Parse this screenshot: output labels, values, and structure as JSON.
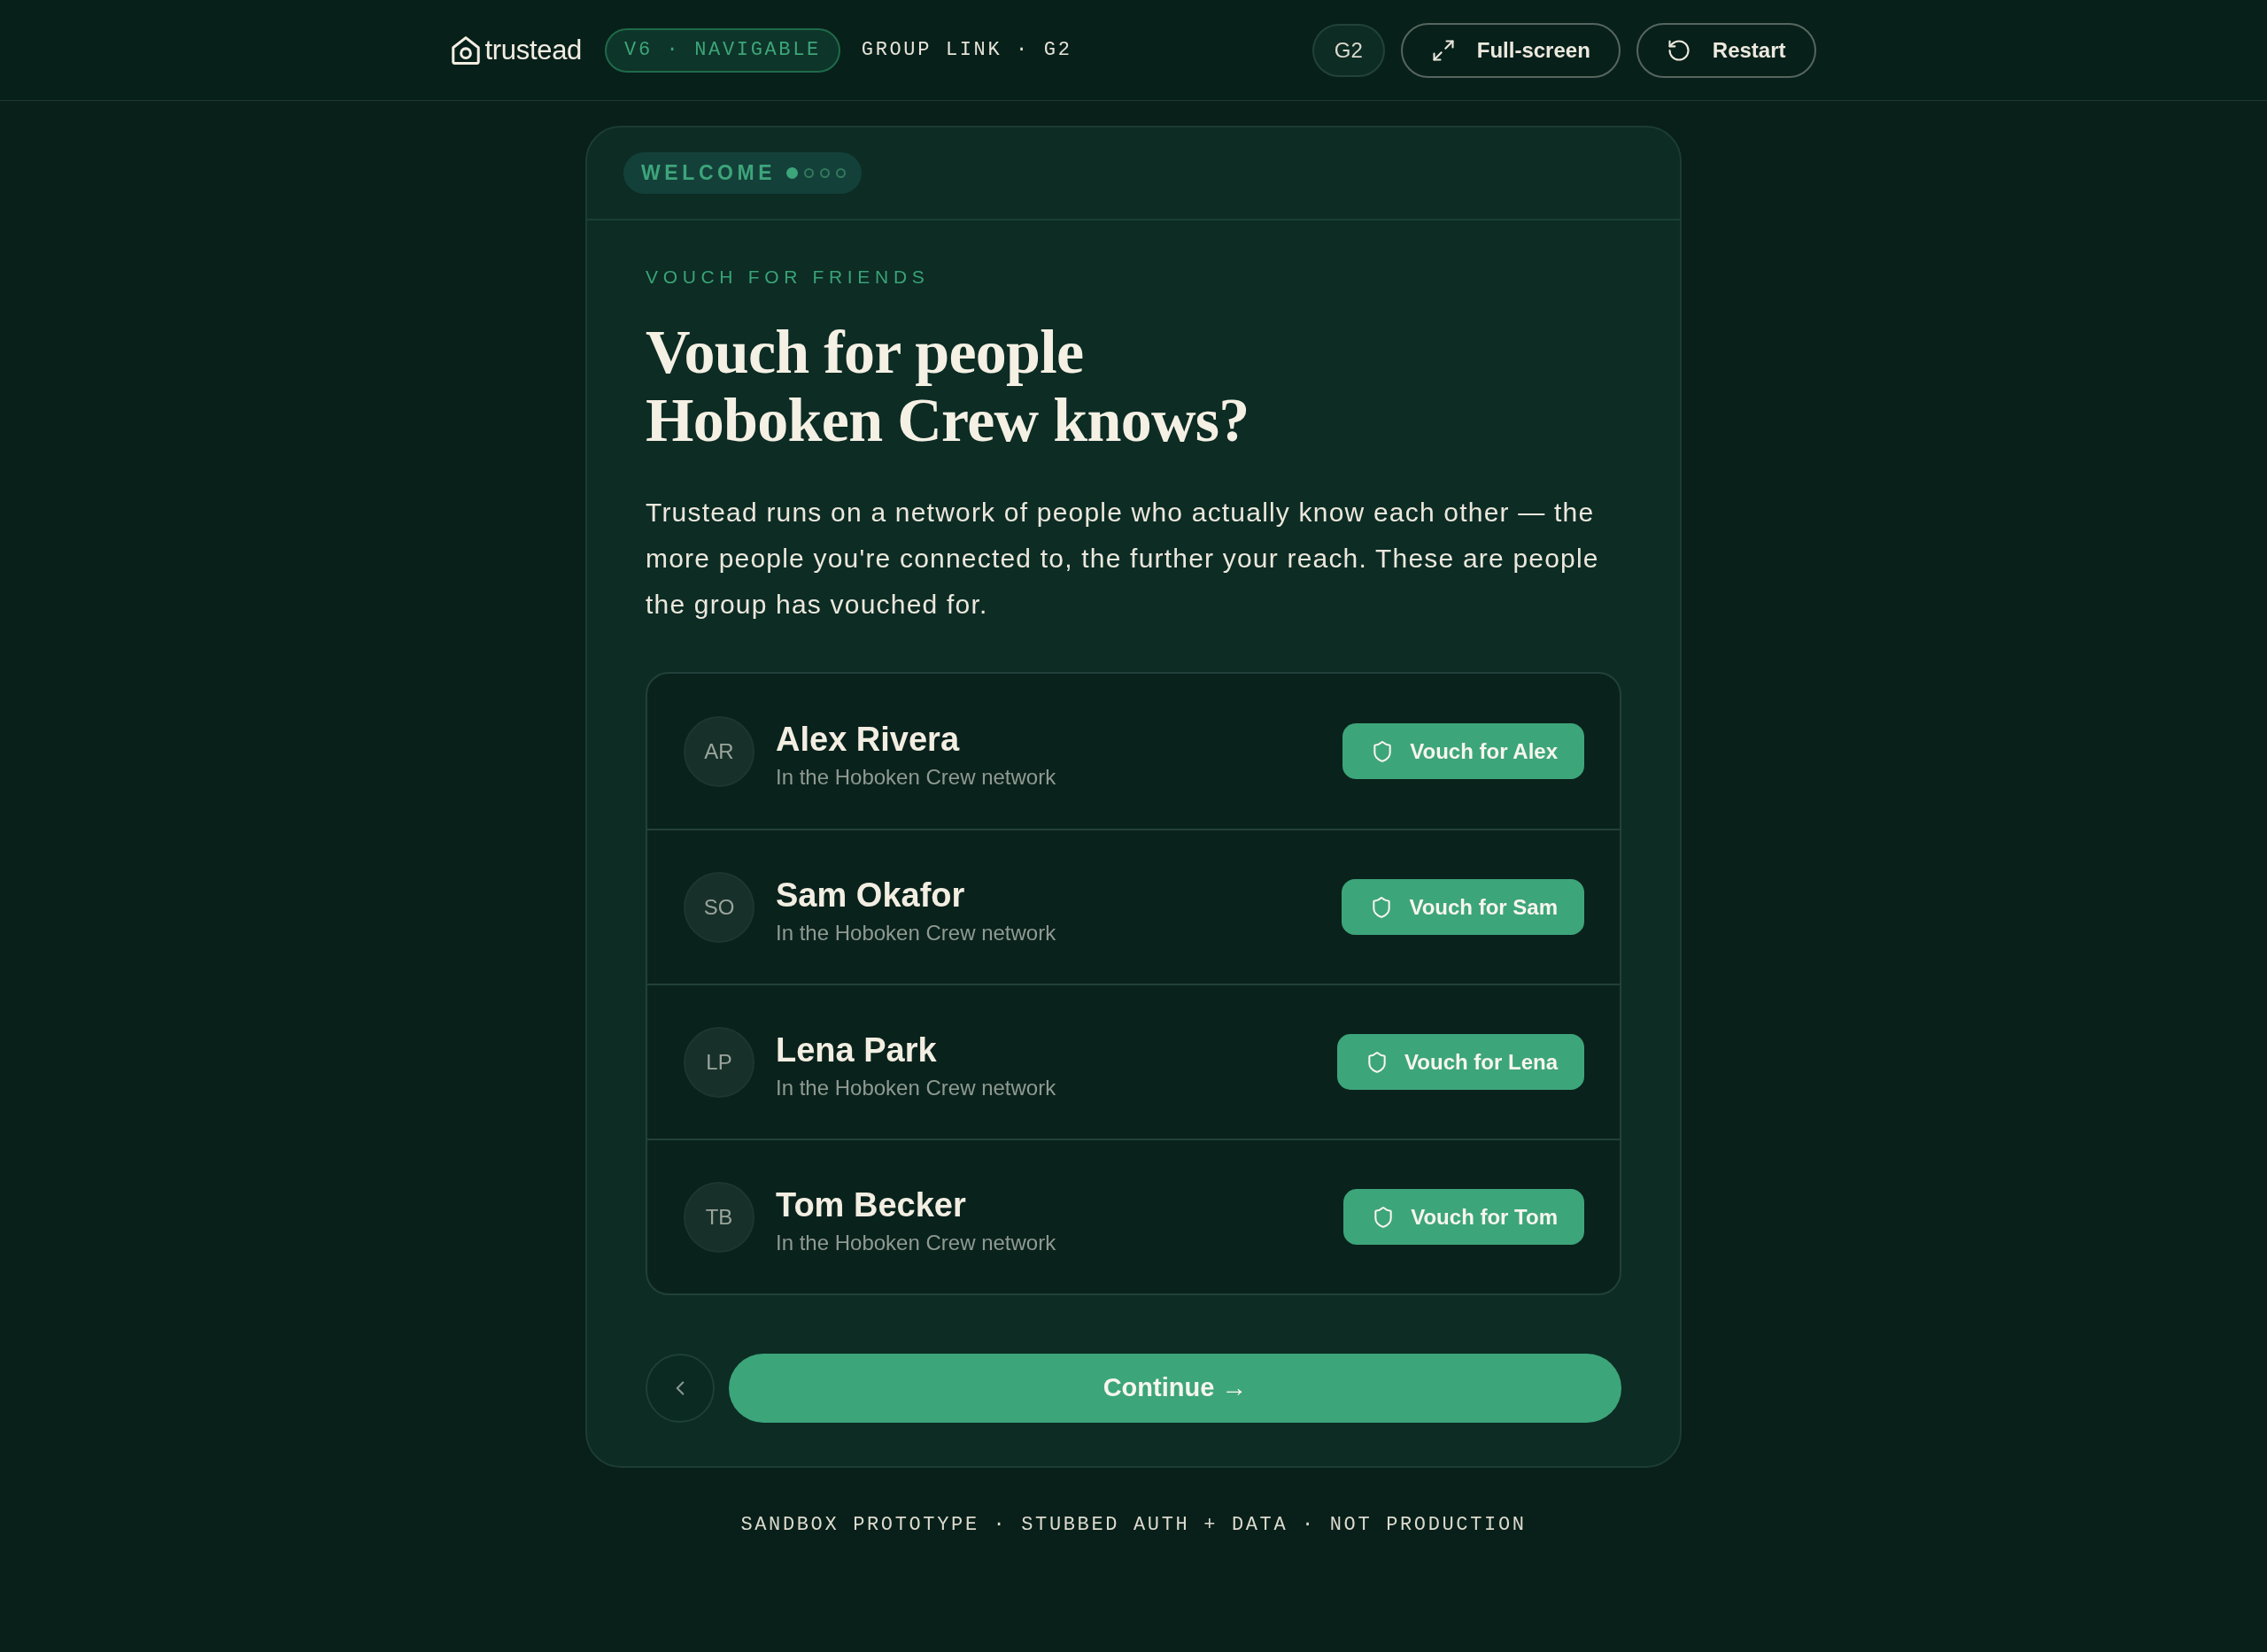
{
  "header": {
    "logo": "trustead",
    "version_badge": "V6 · NAVIGABLE",
    "context": "GROUP LINK · G2",
    "group_badge": "G2",
    "buttons": [
      {
        "kind": "fullscreen",
        "label": "Full-screen"
      },
      {
        "kind": "restart",
        "label": "Restart"
      }
    ]
  },
  "card": {
    "progress": {
      "label": "WELCOME",
      "steps": [
        {
          "active": true
        },
        {
          "active": false
        },
        {
          "active": false
        },
        {
          "active": false
        }
      ]
    },
    "eyebrow": "VOUCH FOR FRIENDS",
    "title_lines": [
      "Vouch for people",
      "Hoboken Crew knows?"
    ],
    "description": "Trustead runs on a network of people who actually know each other — the more people you're connected to, the further your reach. These are people the group has vouched for.",
    "people": [
      {
        "initials": "AR",
        "name": "Alex Rivera",
        "subtitle": "In the Hoboken Crew network",
        "action": "Vouch for Alex"
      },
      {
        "initials": "SO",
        "name": "Sam Okafor",
        "subtitle": "In the Hoboken Crew network",
        "action": "Vouch for Sam"
      },
      {
        "initials": "LP",
        "name": "Lena Park",
        "subtitle": "In the Hoboken Crew network",
        "action": "Vouch for Lena"
      },
      {
        "initials": "TB",
        "name": "Tom Becker",
        "subtitle": "In the Hoboken Crew network",
        "action": "Vouch for Tom"
      }
    ],
    "continue_button": "Continue →"
  },
  "footer": "SANDBOX PROTOTYPE · STUBBED AUTH + DATA · NOT PRODUCTION"
}
